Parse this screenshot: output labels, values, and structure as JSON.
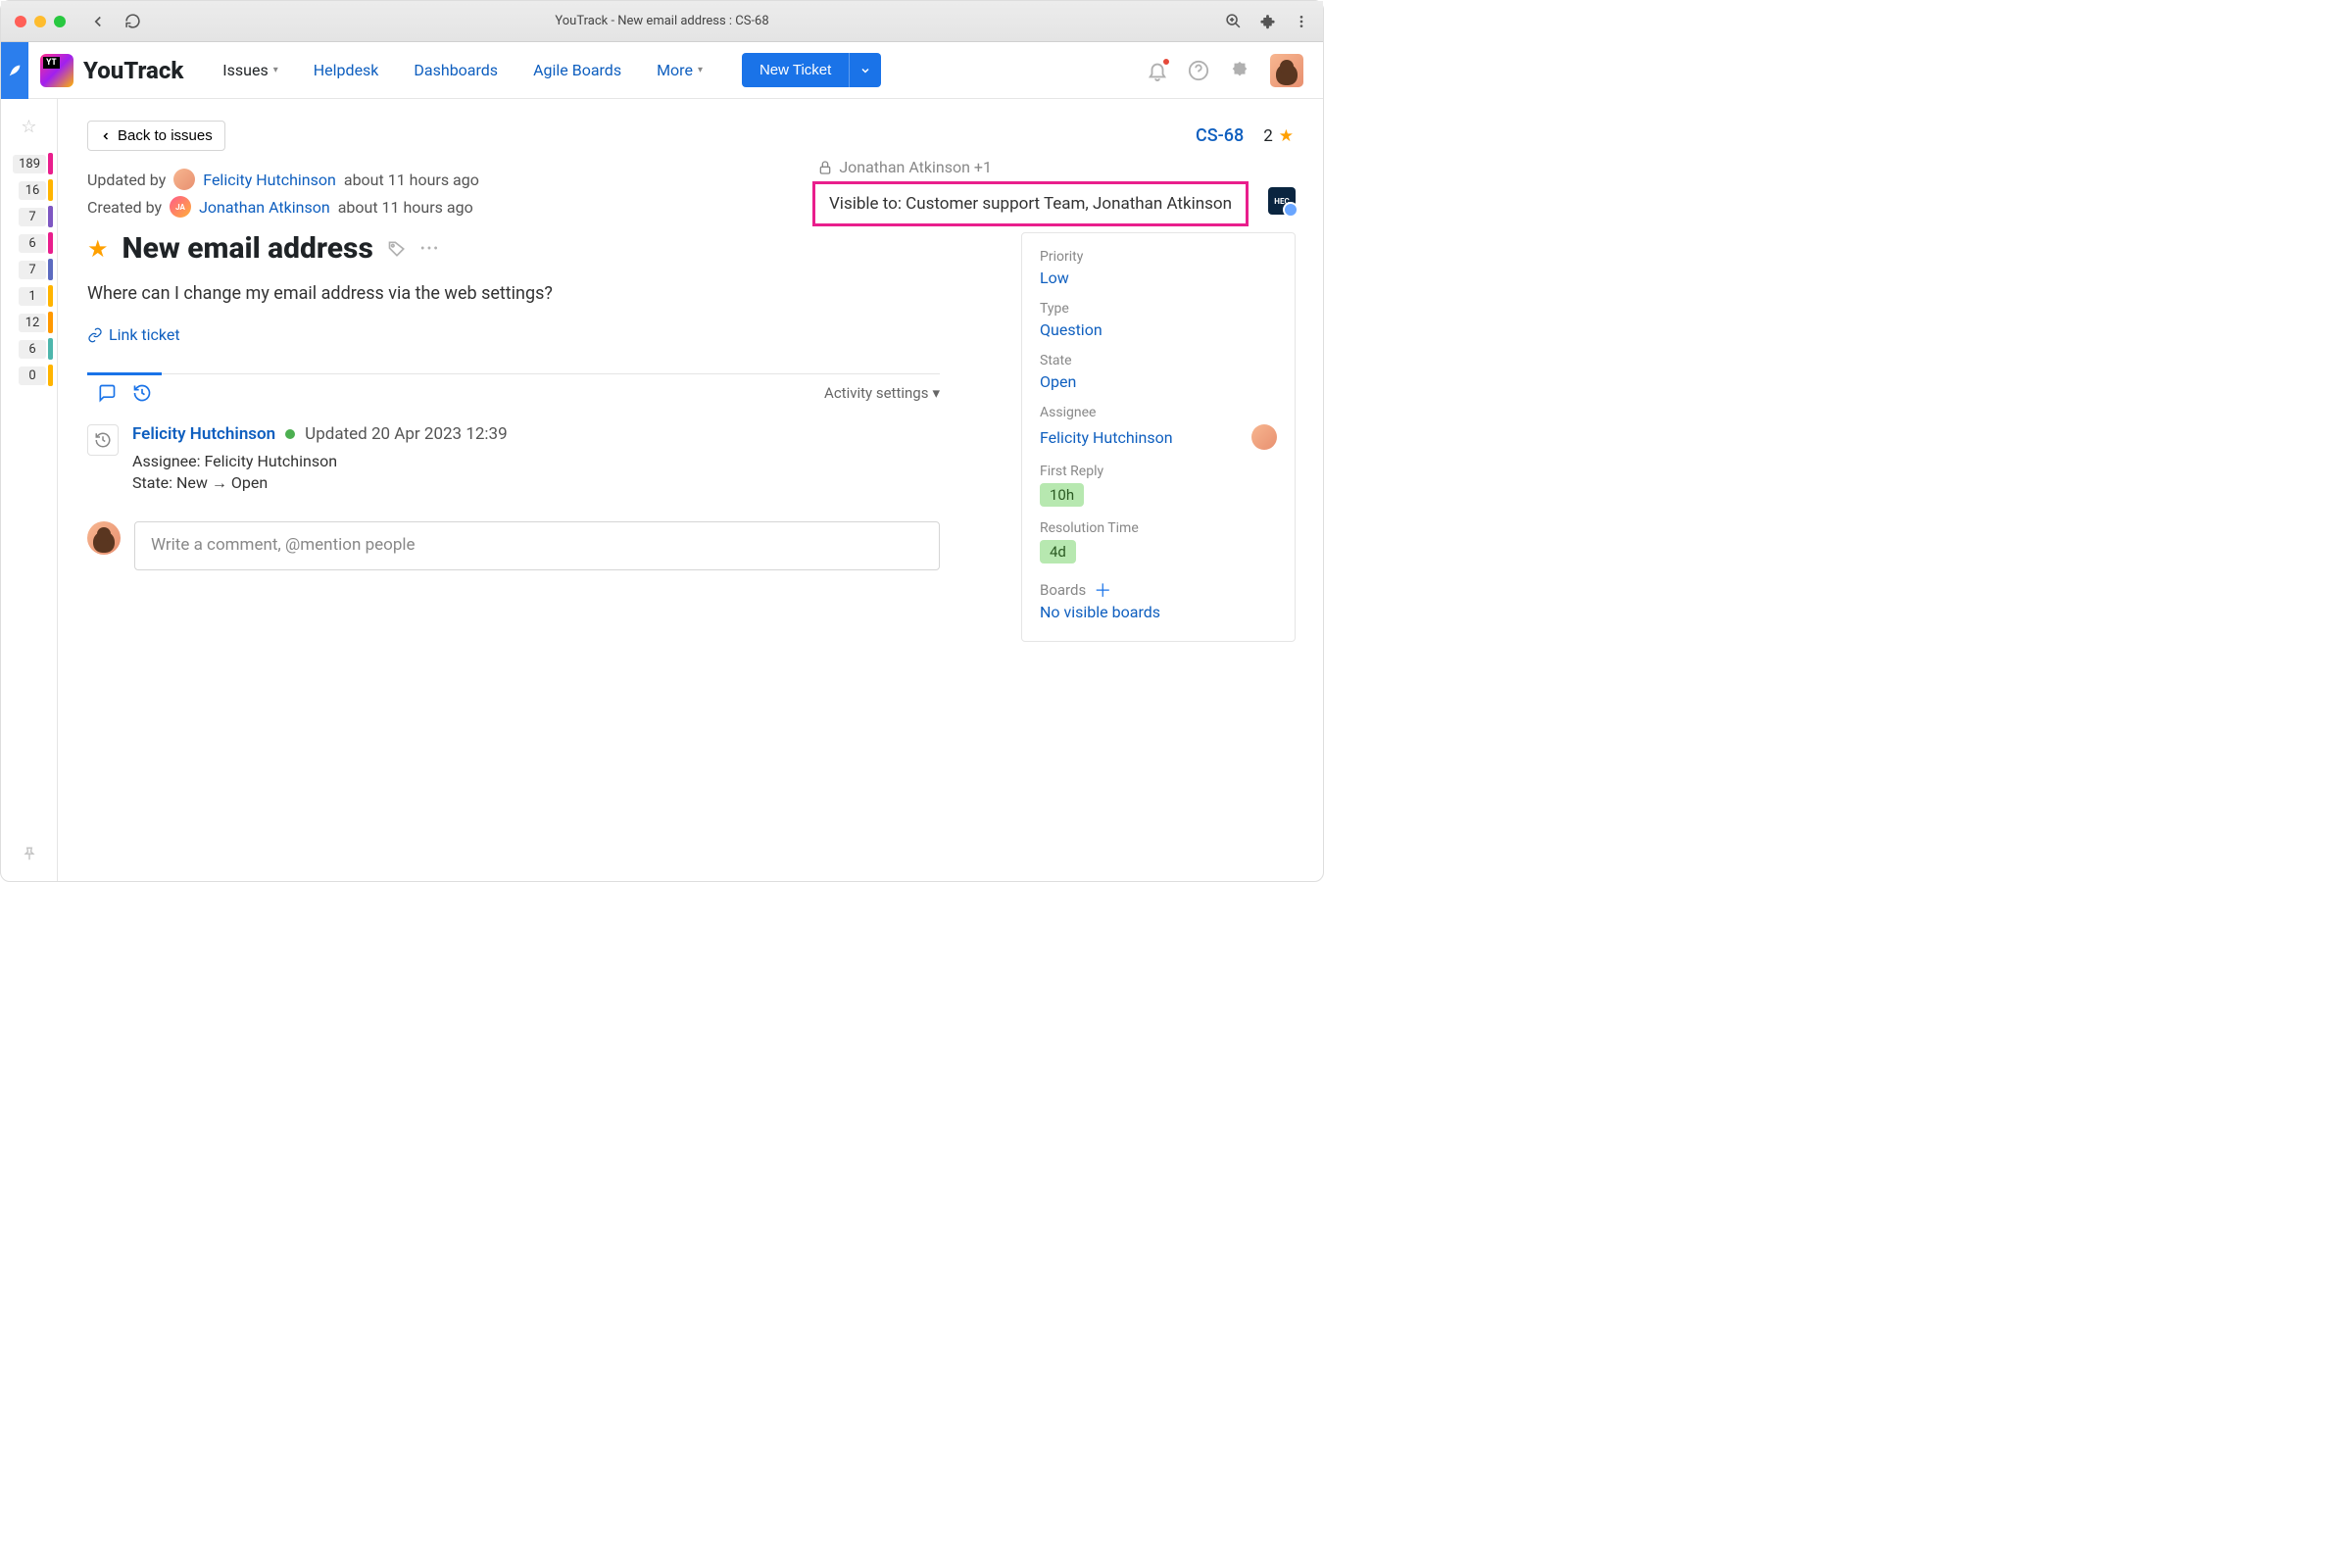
{
  "browser": {
    "title": "YouTrack - New email address : CS-68"
  },
  "nav": {
    "product": "YouTrack",
    "items": [
      "Issues",
      "Helpdesk",
      "Dashboards",
      "Agile Boards",
      "More"
    ],
    "newTicket": "New Ticket"
  },
  "leftRail": [
    {
      "n": "189",
      "color": "#e91e8c"
    },
    {
      "n": "16",
      "color": "#ffb400"
    },
    {
      "n": "7",
      "color": "#7e57c2"
    },
    {
      "n": "6",
      "color": "#e91e8c"
    },
    {
      "n": "7",
      "color": "#5c6bc0"
    },
    {
      "n": "1",
      "color": "#ffb400"
    },
    {
      "n": "12",
      "color": "#ff9800"
    },
    {
      "n": "6",
      "color": "#4db6ac"
    },
    {
      "n": "0",
      "color": "#ffb400"
    }
  ],
  "backLabel": "Back to issues",
  "issueId": "CS-68",
  "starCount": "2",
  "updated": {
    "by": "Felicity Hutchinson",
    "when": "about 11 hours ago",
    "label": "Updated by"
  },
  "created": {
    "by": "Jonathan Atkinson",
    "when": "about 11 hours ago",
    "label": "Created by"
  },
  "watchers": "Jonathan Atkinson +1",
  "visibleTo": "Visible to: Customer support Team, Jonathan Atkinson",
  "title": "New email address",
  "body": "Where can I change my email address via the web settings?",
  "linkTicket": "Link ticket",
  "activitySettings": "Activity settings",
  "activity": {
    "user": "Felicity Hutchinson",
    "when": "Updated 20 Apr 2023 12:39",
    "lines": [
      "Assignee: Felicity Hutchinson",
      "State: New → Open"
    ]
  },
  "commentPlaceholder": "Write a comment, @mention people",
  "sidebar": {
    "priority": {
      "label": "Priority",
      "value": "Low"
    },
    "type": {
      "label": "Type",
      "value": "Question"
    },
    "state": {
      "label": "State",
      "value": "Open"
    },
    "assignee": {
      "label": "Assignee",
      "value": "Felicity Hutchinson"
    },
    "firstReply": {
      "label": "First Reply",
      "value": "10h"
    },
    "resolutionTime": {
      "label": "Resolution Time",
      "value": "4d"
    },
    "boards": {
      "label": "Boards",
      "value": "No visible boards"
    }
  },
  "hec": "HEC"
}
